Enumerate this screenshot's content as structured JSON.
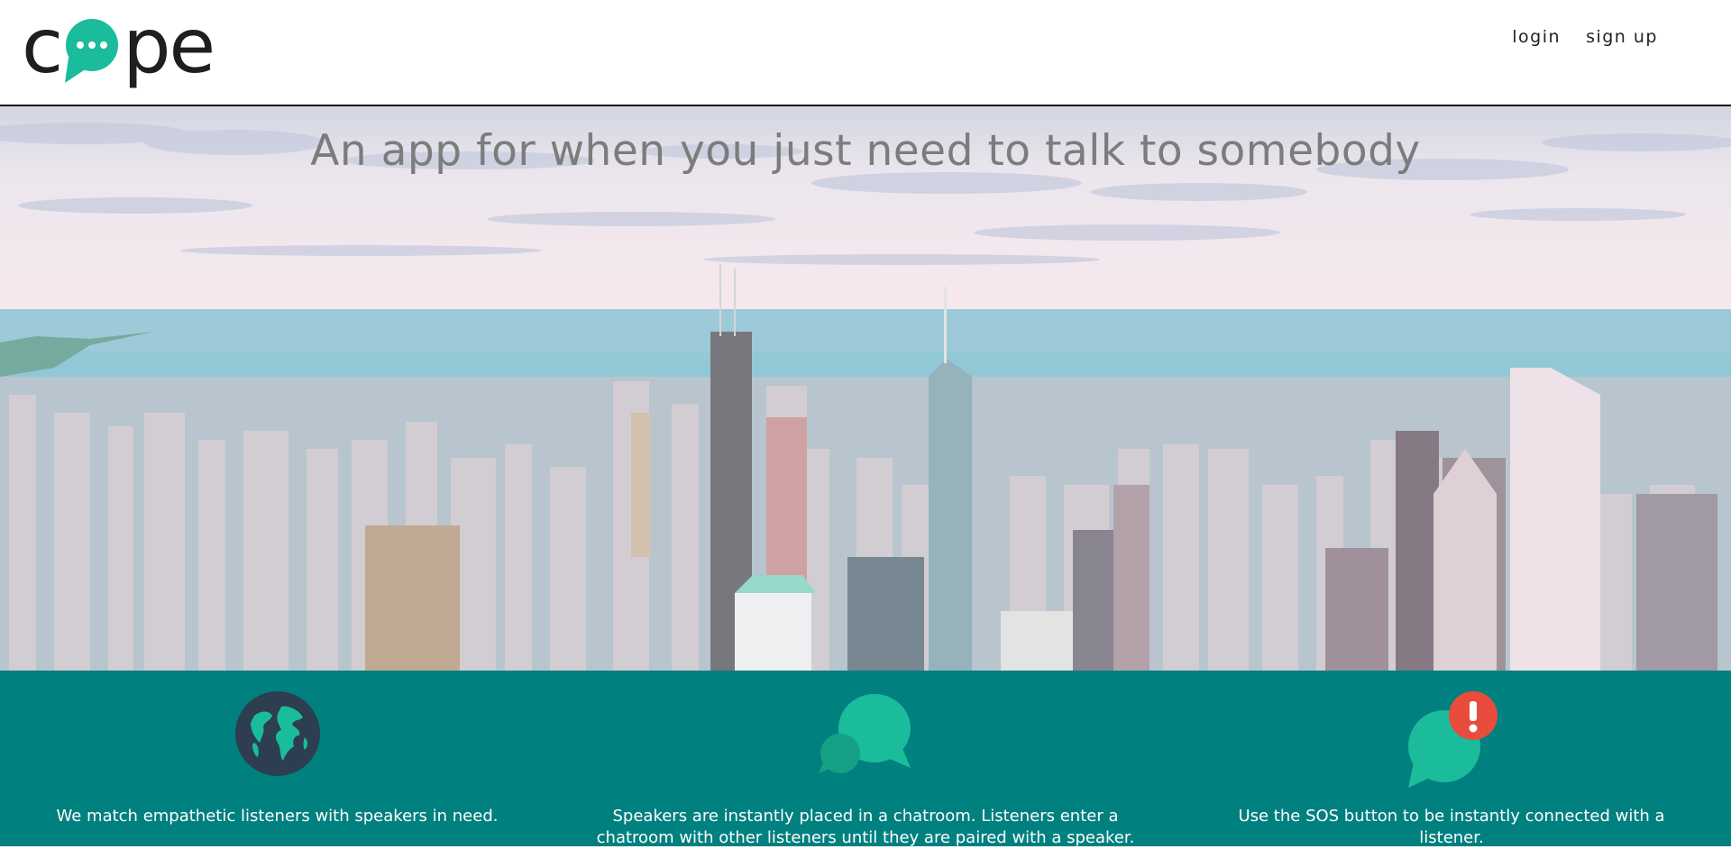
{
  "header": {
    "logo": {
      "left_text": "c",
      "right_text": "pe",
      "icon": "speech-bubble-icon",
      "brand_color": "#1abc9c"
    },
    "nav": [
      {
        "label": "login"
      },
      {
        "label": "sign up"
      }
    ]
  },
  "hero": {
    "title": "An app for when you just need to talk to somebody",
    "background": "city-skyline-image"
  },
  "features": {
    "background_color": "#00807f",
    "items": [
      {
        "icon": "globe-icon",
        "text": "We match empathetic listeners with speakers in need."
      },
      {
        "icon": "chat-bubbles-icon",
        "text": "Speakers are instantly placed in a chatroom. Listeners enter a chatroom with other listeners until they are paired with a speaker."
      },
      {
        "icon": "sos-alert-bubble-icon",
        "text": "Use the SOS button to be instantly connected with a listener."
      }
    ]
  },
  "colors": {
    "accent": "#1abc9c",
    "alert": "#e74c3c",
    "globe": "#2c3e50"
  }
}
